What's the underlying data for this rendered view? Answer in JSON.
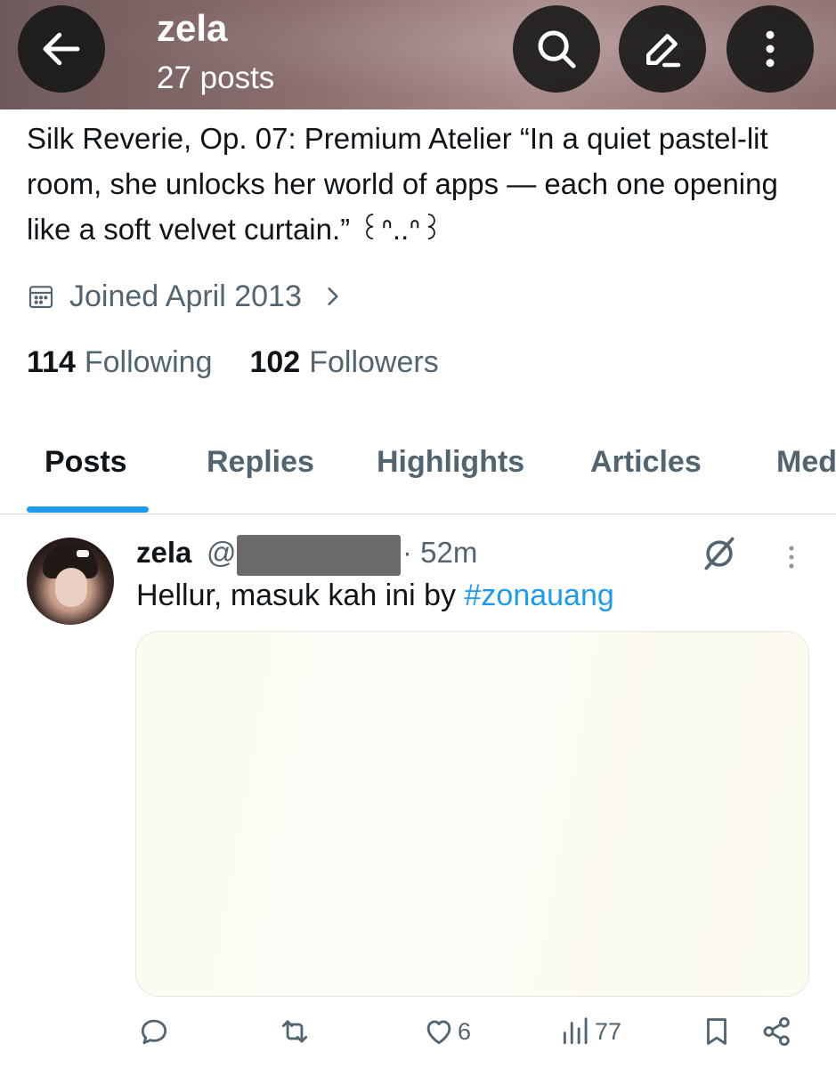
{
  "header": {
    "title": "zela",
    "subtitle": "27 posts"
  },
  "profile": {
    "bio": "Silk Reverie, Op. 07: Premium Atelier “In a quiet pastel-lit room, she unlocks her world of apps — each one opening like a soft velvet curtain.” ꒰ᐢ..ᐢ꒱",
    "joined": "Joined April 2013",
    "following_count": "114",
    "following_label": "Following",
    "followers_count": "102",
    "followers_label": "Followers"
  },
  "tabs": [
    {
      "label": "Posts",
      "active": true
    },
    {
      "label": "Replies"
    },
    {
      "label": "Highlights"
    },
    {
      "label": "Articles"
    },
    {
      "label": "Media"
    }
  ],
  "post": {
    "name": "zela",
    "handle": "@k",
    "time": "· 52m",
    "text": "Hellur, masuk kah ini by ",
    "hashtag": "#zonauang",
    "likes": "6",
    "views": "77"
  },
  "colors": {
    "accent": "#1d9bf0",
    "text_primary": "#0f1419",
    "text_secondary": "#536471"
  },
  "icons": [
    "back-arrow-icon",
    "search-icon",
    "edit-icon",
    "more-vertical-icon",
    "calendar-icon",
    "chevron-right-icon",
    "grok-icon",
    "reply-icon",
    "repost-icon",
    "like-icon",
    "views-icon",
    "bookmark-icon",
    "share-icon"
  ]
}
